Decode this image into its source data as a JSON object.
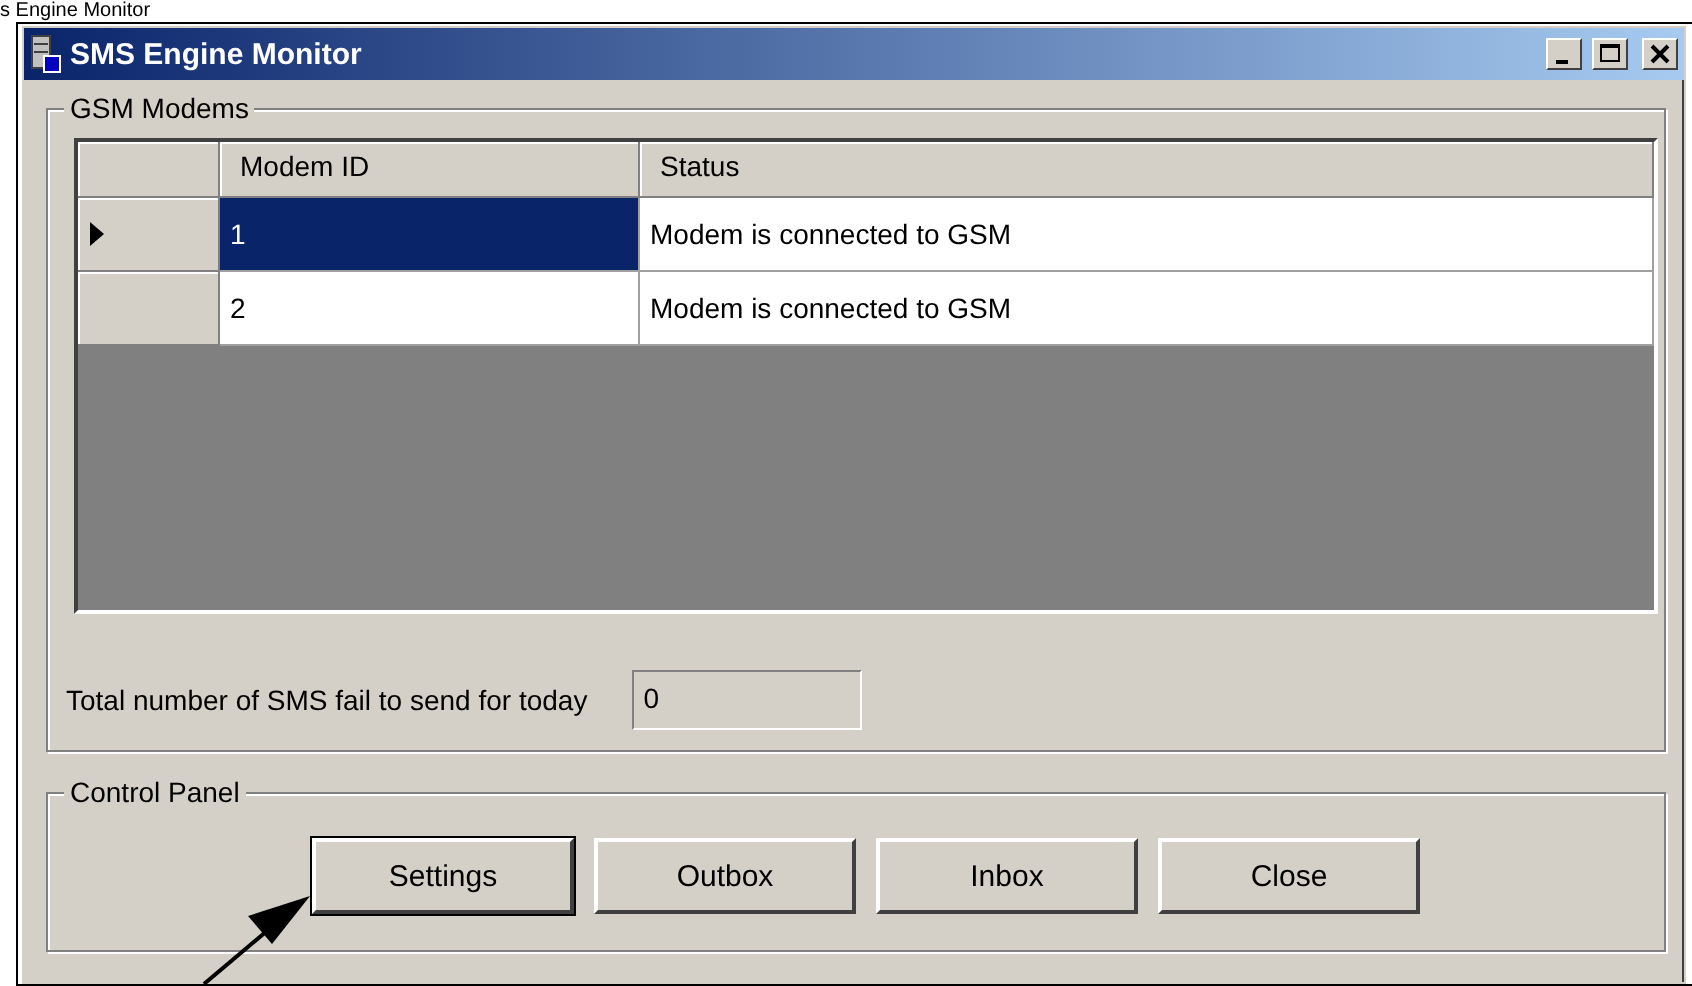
{
  "caption": "s Engine Monitor",
  "window": {
    "title": "SMS Engine Monitor"
  },
  "modems_group": {
    "title": "GSM Modems",
    "table": {
      "columns": [
        "Modem ID",
        "Status"
      ],
      "rows": [
        {
          "cells": [
            "1",
            "Modem is connected to GSM"
          ],
          "selected": true
        },
        {
          "cells": [
            "2",
            "Modem is connected to GSM"
          ],
          "selected": false
        }
      ]
    },
    "fail_count": {
      "label": "Total number of SMS fail to send for today",
      "value": "0"
    }
  },
  "control_group": {
    "title": "Control Panel",
    "buttons": [
      {
        "label": "Settings",
        "default": true
      },
      {
        "label": "Outbox",
        "default": false
      },
      {
        "label": "Inbox",
        "default": false
      },
      {
        "label": "Close",
        "default": false
      }
    ]
  }
}
